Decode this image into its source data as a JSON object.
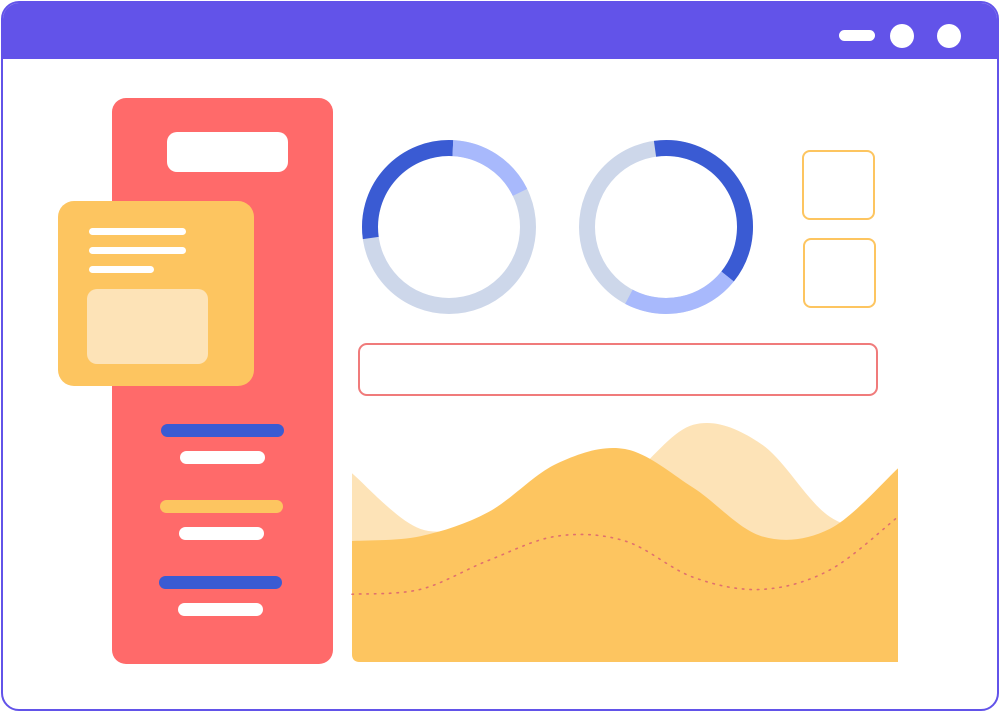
{
  "window": {
    "frame_color": "#6253e9",
    "controls": [
      "minimize-icon",
      "maximize-icon",
      "close-icon"
    ]
  },
  "colors": {
    "sidebar": "#ff6a6a",
    "card": "#fdc560",
    "card_light": "#fde3b7",
    "accent_blue": "#3a5bd3",
    "light_blue": "#a8b9fc",
    "pale_blue": "#cdd7ea",
    "area_light": "#fde3b7",
    "area_dark": "#fdc560"
  },
  "donuts": [
    {
      "fraction": 0.28,
      "secondary_fraction": 0.17
    },
    {
      "fraction": 0.38,
      "secondary_fraction": 0.22
    }
  ],
  "chart_data": {
    "type": "area",
    "series": [
      {
        "values": [
          0.78,
          0.55,
          0.58,
          0.62,
          0.75,
          0.98,
          0.9,
          0.6,
          0.52
        ]
      },
      {
        "values": [
          0.5,
          0.52,
          0.62,
          0.82,
          0.88,
          0.72,
          0.52,
          0.55,
          0.8
        ]
      }
    ],
    "reference_line": [
      0.28,
      0.3,
      0.42,
      0.52,
      0.5,
      0.35,
      0.3,
      0.38,
      0.6
    ],
    "grid": false
  }
}
